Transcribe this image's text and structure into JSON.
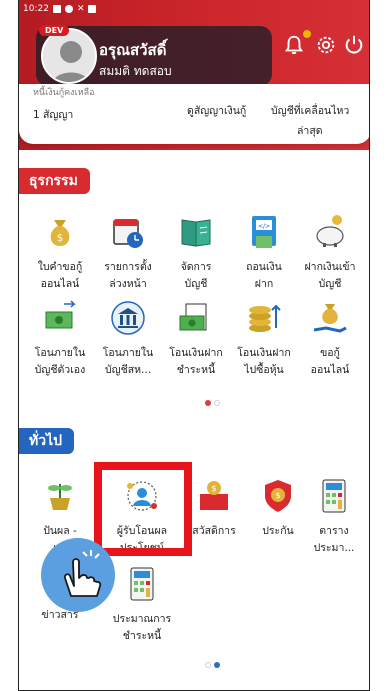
{
  "status_bar": {
    "time": "10:22"
  },
  "profile": {
    "dev_badge": "DEV",
    "name": "อรุณสวัสดิ์",
    "sub": "สมมติ ทดสอบ"
  },
  "summary": {
    "cut_text": "หนี้เงินกู้คงเหลือ",
    "contracts": "1 สัญญา",
    "view_loan": "ดูสัญญาเงินกู้",
    "recent_line1": "บัญชีที่เคลื่อนไหว",
    "recent_line2": "ล่าสุด"
  },
  "sections": {
    "transactions": {
      "label": "ธุรกรรม",
      "color": "#d82a2f"
    },
    "general": {
      "label": "ทั่วไป",
      "color": "#2466bf"
    }
  },
  "transactions": [
    {
      "l1": "ใบคำขอกู้",
      "l2": "ออนไลน์",
      "icon": "money-bag-icon"
    },
    {
      "l1": "รายการตั้ง",
      "l2": "ล่วงหน้า",
      "icon": "calendar-clock-icon"
    },
    {
      "l1": "จัดการ",
      "l2": "บัญชี",
      "icon": "ledger-book-icon"
    },
    {
      "l1": "ถอนเงิน",
      "l2": "ฝาก",
      "icon": "atm-icon"
    },
    {
      "l1": "ฝากเงินเข้า",
      "l2": "บัญชี",
      "icon": "piggy-bank-icon"
    },
    {
      "l1": "โอนภายใน",
      "l2": "บัญชีตัวเอง",
      "icon": "transfer-cash-icon"
    },
    {
      "l1": "โอนภายใน",
      "l2": "บัญชีสห...",
      "icon": "bank-building-icon"
    },
    {
      "l1": "โอนเงินฝาก",
      "l2": "ชำระหนี้",
      "icon": "money-invoice-icon"
    },
    {
      "l1": "โอนเงินฝาก",
      "l2": "ไปซื้อหุ้น",
      "icon": "coins-stack-icon"
    },
    {
      "l1": "ขอกู้",
      "l2": "ออนไลน์",
      "icon": "loan-hand-icon"
    }
  ],
  "general": [
    {
      "l1": "ปันผล -",
      "l2": "เ...",
      "icon": "plant-coins-icon"
    },
    {
      "l1": "ผู้รับโอนผล",
      "l2": "ประโยชน์",
      "icon": "beneficiary-icon"
    },
    {
      "l1": "สวัสดิการ",
      "l2": "",
      "icon": "welfare-icon"
    },
    {
      "l1": "ประกัน",
      "l2": "",
      "icon": "shield-coin-icon"
    },
    {
      "l1": "ตาราง",
      "l2": "ประมา...",
      "icon": "calculator-icon"
    },
    {
      "l1": "ข่าวสาร",
      "l2": "",
      "icon": "news-icon"
    },
    {
      "l1": "ประมาณการ",
      "l2": "ชำระหนี้",
      "icon": "calculator-icon"
    }
  ],
  "colors": {
    "accent_red": "#d82a2f",
    "accent_blue": "#2466bf",
    "highlight": "#e8141c"
  }
}
